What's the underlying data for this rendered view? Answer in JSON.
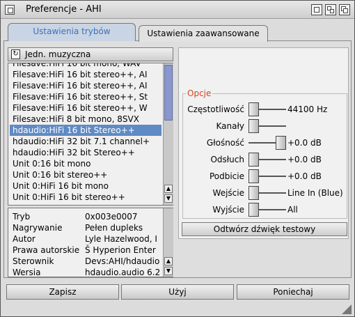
{
  "window": {
    "title": "Preferencje - AHI"
  },
  "tabs": [
    {
      "label": "Ustawienia trybów",
      "active": true
    },
    {
      "label": "Ustawienia zaawansowane",
      "active": false
    }
  ],
  "device": {
    "icon": "cycle-icon",
    "label": "Jedn. muzyczna"
  },
  "modes": [
    "Filesave:HiFi 16 bit mono, WAV",
    "Filesave:HiFi 16 bit stereo++, AI",
    "Filesave:HiFi 16 bit stereo++, AI",
    "Filesave:HiFi 16 bit stereo++, St",
    "Filesave:HiFi 16 bit stereo++, W",
    "Filesave:HiFi 8 bit mono, 8SVX",
    "hdaudio:HiFi 16 bit Stereo++",
    "hdaudio:HiFi 32 bit 7.1 channel+",
    "hdaudio:HiFi 32 bit Stereo++",
    "Unit 0:16 bit mono",
    "Unit 0:16 bit stereo++",
    "Unit 0:HiFi 16 bit mono",
    "Unit 0:HiFi 16 bit stereo++"
  ],
  "selected_mode_index": 6,
  "info": [
    {
      "key": "Tryb",
      "value": "0x003e0007"
    },
    {
      "key": "Nagrywanie",
      "value": "Pełen dupleks"
    },
    {
      "key": "Autor",
      "value": "Lyle Hazelwood, I"
    },
    {
      "key": "Prawa autorskie",
      "value": "Š Hyperion Enter"
    },
    {
      "key": "Sterownik",
      "value": "Devs:AHI/hdaudio"
    },
    {
      "key": "Wersja",
      "value": "hdaudio.audio 6.2"
    }
  ],
  "options": {
    "group_label": "Opcje",
    "rows": [
      {
        "label": "Częstotliwość",
        "value": "44100 Hz",
        "level": 0.0
      },
      {
        "label": "Kanały",
        "value": "",
        "level": 0.0
      },
      {
        "label": "Głośność",
        "value": "+0.0 dB",
        "level": 1.0
      },
      {
        "label": "Odsłuch",
        "value": "+0.0 dB",
        "level": 0.0
      },
      {
        "label": "Podbicie",
        "value": "+0.0 dB",
        "level": 0.0
      },
      {
        "label": "Wejście",
        "value": "Line In (Blue)",
        "level": 0.0
      },
      {
        "label": "Wyjście",
        "value": "All",
        "level": 0.0
      }
    ],
    "test_button": "Odtwórz dźwięk testowy"
  },
  "buttons": {
    "save": "Zapisz",
    "use": "Użyj",
    "cancel": "Poniechaj"
  }
}
